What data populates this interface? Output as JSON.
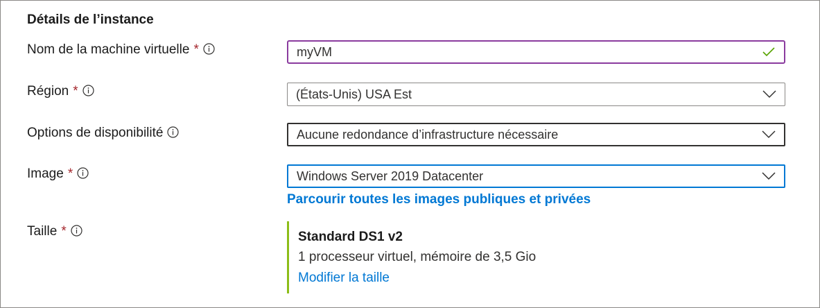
{
  "section": {
    "title": "Détails de l’instance"
  },
  "fields": {
    "vm_name": {
      "label": "Nom de la machine virtuelle",
      "required": "*",
      "value": "myVM"
    },
    "region": {
      "label": "Région",
      "required": "*",
      "value": "(États-Unis) USA Est"
    },
    "availability": {
      "label": "Options de disponibilité",
      "value": "Aucune redondance d’infrastructure nécessaire"
    },
    "image": {
      "label": "Image",
      "required": "*",
      "value": "Windows Server 2019 Datacenter",
      "browse_link": "Parcourir toutes les images publiques et privées"
    },
    "size": {
      "label": "Taille",
      "required": "*",
      "name": "Standard DS1 v2",
      "description": "1 processeur virtuel, mémoire de 3,5 Gio",
      "change_link": "Modifier la taille"
    }
  },
  "icons": {
    "info": "info-circle-icon",
    "valid": "checkmark-icon",
    "dropdown": "chevron-down-icon"
  },
  "colors": {
    "required": "#a4262c",
    "link": "#0078d4",
    "valid_check": "#57a300",
    "name_border": "#8a3b9e",
    "focus_border": "#0078d4",
    "size_accent": "#8cbd18"
  }
}
